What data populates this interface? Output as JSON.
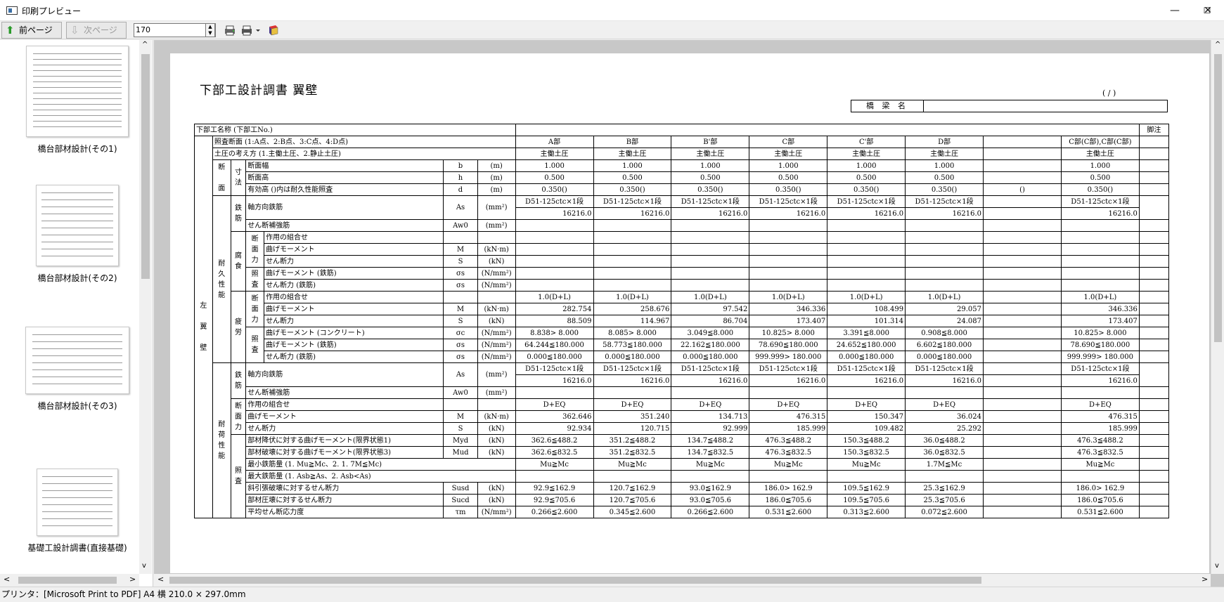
{
  "window": {
    "title": "印刷プレビュー",
    "minimize": "—",
    "maximize": "☐",
    "close": "✕"
  },
  "toolbar": {
    "prev_label": "前ページ",
    "next_label": "次ページ",
    "zoom_value": "170",
    "zoom_up": "▲",
    "zoom_down": "▼",
    "icons": [
      "print-setup-icon",
      "print-icon",
      "dropdown-arrow-icon",
      "book-icon"
    ]
  },
  "thumbnails": [
    {
      "label": "橋台部材設計(その1)"
    },
    {
      "label": "橋台部材設計(その2)"
    },
    {
      "label": "橋台部材設計(その3)"
    },
    {
      "label": "基礎工設計調書(直接基礎)"
    }
  ],
  "scroll_arrows": {
    "up": "^",
    "down": "v",
    "left": "<",
    "right": ">"
  },
  "status": {
    "printer": "プリンタ：[Microsoft Print to PDF] A4 横  210.0 × 297.0mm"
  },
  "doc": {
    "title": "下部工設計調書  翼壁",
    "page_counter": "(  /  )",
    "bridge_name_label": "橋 梁 名",
    "bridge_name_value": "",
    "header_label": "下部工名称 (下部工No.)",
    "notes_label": "脚注",
    "side_label": "左\n\n翼\n\n壁",
    "section_label": "断\n\n面",
    "dims_label": "寸\n法",
    "durability_label": "耐\n久\n性\n能",
    "rebar_label": "鉄\n筋",
    "corrosion_label": "腐\n食",
    "force_label": "断\n面\n力",
    "check_label": "照\n査",
    "fatigue_label": "疲\n労",
    "loadcap_label": "耐\n荷\n性\n能",
    "rows": {
      "check_section": {
        "label": "照査断面  (1:A点、2:B点、3:C点、4:D点)",
        "vals": [
          "A部",
          "B部",
          "B'部",
          "C部",
          "C'部",
          "D部",
          "",
          "C部(C部),C部(C部)"
        ]
      },
      "earth_pressure": {
        "label": "土圧の考え方 (1.主働土圧、2.静止土圧)",
        "vals": [
          "主働土圧",
          "主働土圧",
          "主働土圧",
          "主働土圧",
          "主働土圧",
          "主働土圧",
          "",
          "主働土圧"
        ]
      },
      "b": {
        "label": "断面幅",
        "sym": "b",
        "unit": "(m)",
        "vals": [
          "1.000",
          "1.000",
          "1.000",
          "1.000",
          "1.000",
          "1.000",
          "",
          "1.000"
        ]
      },
      "h": {
        "label": "断面高",
        "sym": "h",
        "unit": "(m)",
        "vals": [
          "0.500",
          "0.500",
          "0.500",
          "0.500",
          "0.500",
          "0.500",
          "",
          "0.500"
        ]
      },
      "d": {
        "label": "有効高 ()内は耐久性能照査",
        "sym": "d",
        "unit": "(m)",
        "vals": [
          "0.350()",
          "0.350()",
          "0.350()",
          "0.350()",
          "0.350()",
          "0.350()",
          "()",
          "0.350()"
        ]
      },
      "as1": {
        "label": "軸方向鉄筋",
        "sym": "As",
        "unit": "(mm²)",
        "top": [
          "D51-125ctc×1段",
          "D51-125ctc×1段",
          "D51-125ctc×1段",
          "D51-125ctc×1段",
          "D51-125ctc×1段",
          "D51-125ctc×1段",
          "",
          "D51-125ctc×1段"
        ],
        "bottom": [
          "16216.0",
          "16216.0",
          "16216.0",
          "16216.0",
          "16216.0",
          "16216.0",
          "",
          "16216.0"
        ]
      },
      "aw1": {
        "label": "せん断補強筋",
        "sym": "Aw0",
        "unit": "(mm²)"
      },
      "cor_comb": {
        "label": "作用の組合せ"
      },
      "cor_m": {
        "label": "曲げモーメント",
        "sym": "M",
        "unit": "(kN·m)"
      },
      "cor_s": {
        "label": "せん断力",
        "sym": "S",
        "unit": "(kN)"
      },
      "cor_sm": {
        "label": "曲げモーメント (鉄筋)",
        "sym": "σs",
        "unit": "(N/mm²)"
      },
      "cor_ss": {
        "label": "せん断力 (鉄筋)",
        "sym": "σs",
        "unit": "(N/mm²)"
      },
      "fat_comb": {
        "label": "作用の組合せ",
        "vals": [
          "1.0(D+L)",
          "1.0(D+L)",
          "1.0(D+L)",
          "1.0(D+L)",
          "1.0(D+L)",
          "1.0(D+L)",
          "",
          "1.0(D+L)"
        ]
      },
      "fat_m": {
        "label": "曲げモーメント",
        "sym": "M",
        "unit": "(kN·m)",
        "vals": [
          "282.754",
          "258.676",
          "97.542",
          "346.336",
          "108.499",
          "29.057",
          "",
          "346.336"
        ]
      },
      "fat_s": {
        "label": "せん断力",
        "sym": "S",
        "unit": "(kN)",
        "vals": [
          "88.509",
          "114.967",
          "86.704",
          "173.407",
          "101.314",
          "24.087",
          "",
          "173.407"
        ]
      },
      "fat_sc": {
        "label": "曲げモーメント (コンクリート)",
        "sym": "σc",
        "unit": "(N/mm²)",
        "vals": [
          "8.838> 8.000",
          "8.085> 8.000",
          "3.049≦8.000",
          "10.825> 8.000",
          "3.391≦8.000",
          "0.908≦8.000",
          "",
          "10.825> 8.000"
        ]
      },
      "fat_sm": {
        "label": "曲げモーメント (鉄筋)",
        "sym": "σs",
        "unit": "(N/mm²)",
        "vals": [
          "64.244≦180.000",
          "58.773≦180.000",
          "22.162≦180.000",
          "78.690≦180.000",
          "24.652≦180.000",
          "6.602≦180.000",
          "",
          "78.690≦180.000"
        ]
      },
      "fat_ss": {
        "label": "せん断力 (鉄筋)",
        "sym": "σs",
        "unit": "(N/mm²)",
        "vals": [
          "0.000≦180.000",
          "0.000≦180.000",
          "0.000≦180.000",
          "999.999> 180.000",
          "0.000≦180.000",
          "0.000≦180.000",
          "",
          "999.999> 180.000"
        ]
      },
      "as2": {
        "label": "軸方向鉄筋",
        "sym": "As",
        "unit": "(mm²)",
        "top": [
          "D51-125ctc×1段",
          "D51-125ctc×1段",
          "D51-125ctc×1段",
          "D51-125ctc×1段",
          "D51-125ctc×1段",
          "D51-125ctc×1段",
          "",
          "D51-125ctc×1段"
        ],
        "bottom": [
          "16216.0",
          "16216.0",
          "16216.0",
          "16216.0",
          "16216.0",
          "16216.0",
          "",
          "16216.0"
        ]
      },
      "aw2": {
        "label": "せん断補強筋",
        "sym": "Aw0",
        "unit": "(mm²)"
      },
      "lc_comb": {
        "label": "作用の組合せ",
        "vals": [
          "D+EQ",
          "D+EQ",
          "D+EQ",
          "D+EQ",
          "D+EQ",
          "D+EQ",
          "",
          "D+EQ"
        ]
      },
      "lc_m": {
        "label": "曲げモーメント",
        "sym": "M",
        "unit": "(kN·m)",
        "vals": [
          "362.646",
          "351.240",
          "134.713",
          "476.315",
          "150.347",
          "36.024",
          "",
          "476.315"
        ]
      },
      "lc_s": {
        "label": "せん断力",
        "sym": "S",
        "unit": "(kN)",
        "vals": [
          "92.934",
          "120.715",
          "92.999",
          "185.999",
          "109.482",
          "25.292",
          "",
          "185.999"
        ]
      },
      "myd": {
        "label": "部材降伏に対する曲げモーメント(限界状態1)",
        "sym": "Myd",
        "unit": "(kN)",
        "vals": [
          "362.6≦488.2",
          "351.2≦488.2",
          "134.7≦488.2",
          "476.3≦488.2",
          "150.3≦488.2",
          "36.0≦488.2",
          "",
          "476.3≦488.2"
        ]
      },
      "mud": {
        "label": "部材破壊に対する曲げモーメント(限界状態3)",
        "sym": "Mud",
        "unit": "(kN)",
        "vals": [
          "362.6≦832.5",
          "351.2≦832.5",
          "134.7≦832.5",
          "476.3≦832.5",
          "150.3≦832.5",
          "36.0≦832.5",
          "",
          "476.3≦832.5"
        ]
      },
      "minrebar": {
        "label": "最小鉄筋量  (1. Mu≧Mc、2. 1. 7M≦Mc)",
        "vals": [
          "Mu≧Mc",
          "Mu≧Mc",
          "Mu≧Mc",
          "Mu≧Mc",
          "Mu≧Mc",
          "1.7M≦Mc",
          "",
          "Mu≧Mc"
        ]
      },
      "maxrebar": {
        "label": "最大鉄筋量  (1. Asb≧As、2. Asb<As)"
      },
      "susd": {
        "label": "斜引張破壊に対するせん断力",
        "sym": "Susd",
        "unit": "(kN)",
        "vals": [
          "92.9≦162.9",
          "120.7≦162.9",
          "93.0≦162.9",
          "186.0> 162.9",
          "109.5≦162.9",
          "25.3≦162.9",
          "",
          "186.0> 162.9"
        ]
      },
      "sucd": {
        "label": "部材圧壊に対するせん断力",
        "sym": "Sucd",
        "unit": "(kN)",
        "vals": [
          "92.9≦705.6",
          "120.7≦705.6",
          "93.0≦705.6",
          "186.0≦705.6",
          "109.5≦705.6",
          "25.3≦705.6",
          "",
          "186.0≦705.6"
        ]
      },
      "tau": {
        "label": "平均せん断応力度",
        "sym": "τm",
        "unit": "(N/mm²)",
        "vals": [
          "0.266≦2.600",
          "0.345≦2.600",
          "0.266≦2.600",
          "0.531≦2.600",
          "0.313≦2.600",
          "0.072≦2.600",
          "",
          "0.531≦2.600"
        ]
      }
    }
  }
}
